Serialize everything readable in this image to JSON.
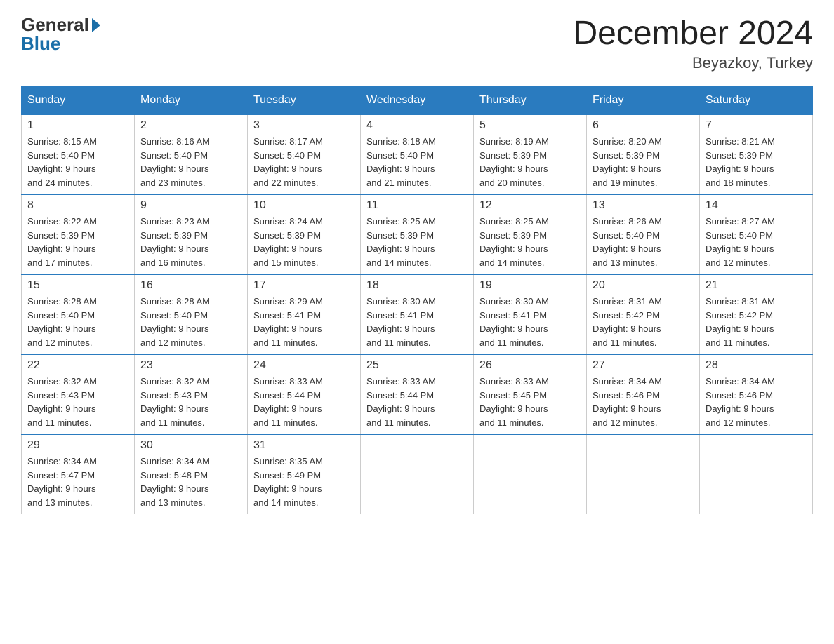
{
  "header": {
    "logo_general": "General",
    "logo_blue": "Blue",
    "month_year": "December 2024",
    "location": "Beyazkoy, Turkey"
  },
  "weekdays": [
    "Sunday",
    "Monday",
    "Tuesday",
    "Wednesday",
    "Thursday",
    "Friday",
    "Saturday"
  ],
  "weeks": [
    [
      {
        "day": "1",
        "sunrise": "8:15 AM",
        "sunset": "5:40 PM",
        "daylight": "9 hours and 24 minutes."
      },
      {
        "day": "2",
        "sunrise": "8:16 AM",
        "sunset": "5:40 PM",
        "daylight": "9 hours and 23 minutes."
      },
      {
        "day": "3",
        "sunrise": "8:17 AM",
        "sunset": "5:40 PM",
        "daylight": "9 hours and 22 minutes."
      },
      {
        "day": "4",
        "sunrise": "8:18 AM",
        "sunset": "5:40 PM",
        "daylight": "9 hours and 21 minutes."
      },
      {
        "day": "5",
        "sunrise": "8:19 AM",
        "sunset": "5:39 PM",
        "daylight": "9 hours and 20 minutes."
      },
      {
        "day": "6",
        "sunrise": "8:20 AM",
        "sunset": "5:39 PM",
        "daylight": "9 hours and 19 minutes."
      },
      {
        "day": "7",
        "sunrise": "8:21 AM",
        "sunset": "5:39 PM",
        "daylight": "9 hours and 18 minutes."
      }
    ],
    [
      {
        "day": "8",
        "sunrise": "8:22 AM",
        "sunset": "5:39 PM",
        "daylight": "9 hours and 17 minutes."
      },
      {
        "day": "9",
        "sunrise": "8:23 AM",
        "sunset": "5:39 PM",
        "daylight": "9 hours and 16 minutes."
      },
      {
        "day": "10",
        "sunrise": "8:24 AM",
        "sunset": "5:39 PM",
        "daylight": "9 hours and 15 minutes."
      },
      {
        "day": "11",
        "sunrise": "8:25 AM",
        "sunset": "5:39 PM",
        "daylight": "9 hours and 14 minutes."
      },
      {
        "day": "12",
        "sunrise": "8:25 AM",
        "sunset": "5:39 PM",
        "daylight": "9 hours and 14 minutes."
      },
      {
        "day": "13",
        "sunrise": "8:26 AM",
        "sunset": "5:40 PM",
        "daylight": "9 hours and 13 minutes."
      },
      {
        "day": "14",
        "sunrise": "8:27 AM",
        "sunset": "5:40 PM",
        "daylight": "9 hours and 12 minutes."
      }
    ],
    [
      {
        "day": "15",
        "sunrise": "8:28 AM",
        "sunset": "5:40 PM",
        "daylight": "9 hours and 12 minutes."
      },
      {
        "day": "16",
        "sunrise": "8:28 AM",
        "sunset": "5:40 PM",
        "daylight": "9 hours and 12 minutes."
      },
      {
        "day": "17",
        "sunrise": "8:29 AM",
        "sunset": "5:41 PM",
        "daylight": "9 hours and 11 minutes."
      },
      {
        "day": "18",
        "sunrise": "8:30 AM",
        "sunset": "5:41 PM",
        "daylight": "9 hours and 11 minutes."
      },
      {
        "day": "19",
        "sunrise": "8:30 AM",
        "sunset": "5:41 PM",
        "daylight": "9 hours and 11 minutes."
      },
      {
        "day": "20",
        "sunrise": "8:31 AM",
        "sunset": "5:42 PM",
        "daylight": "9 hours and 11 minutes."
      },
      {
        "day": "21",
        "sunrise": "8:31 AM",
        "sunset": "5:42 PM",
        "daylight": "9 hours and 11 minutes."
      }
    ],
    [
      {
        "day": "22",
        "sunrise": "8:32 AM",
        "sunset": "5:43 PM",
        "daylight": "9 hours and 11 minutes."
      },
      {
        "day": "23",
        "sunrise": "8:32 AM",
        "sunset": "5:43 PM",
        "daylight": "9 hours and 11 minutes."
      },
      {
        "day": "24",
        "sunrise": "8:33 AM",
        "sunset": "5:44 PM",
        "daylight": "9 hours and 11 minutes."
      },
      {
        "day": "25",
        "sunrise": "8:33 AM",
        "sunset": "5:44 PM",
        "daylight": "9 hours and 11 minutes."
      },
      {
        "day": "26",
        "sunrise": "8:33 AM",
        "sunset": "5:45 PM",
        "daylight": "9 hours and 11 minutes."
      },
      {
        "day": "27",
        "sunrise": "8:34 AM",
        "sunset": "5:46 PM",
        "daylight": "9 hours and 12 minutes."
      },
      {
        "day": "28",
        "sunrise": "8:34 AM",
        "sunset": "5:46 PM",
        "daylight": "9 hours and 12 minutes."
      }
    ],
    [
      {
        "day": "29",
        "sunrise": "8:34 AM",
        "sunset": "5:47 PM",
        "daylight": "9 hours and 13 minutes."
      },
      {
        "day": "30",
        "sunrise": "8:34 AM",
        "sunset": "5:48 PM",
        "daylight": "9 hours and 13 minutes."
      },
      {
        "day": "31",
        "sunrise": "8:35 AM",
        "sunset": "5:49 PM",
        "daylight": "9 hours and 14 minutes."
      },
      null,
      null,
      null,
      null
    ]
  ],
  "labels": {
    "sunrise": "Sunrise:",
    "sunset": "Sunset:",
    "daylight": "Daylight:"
  }
}
